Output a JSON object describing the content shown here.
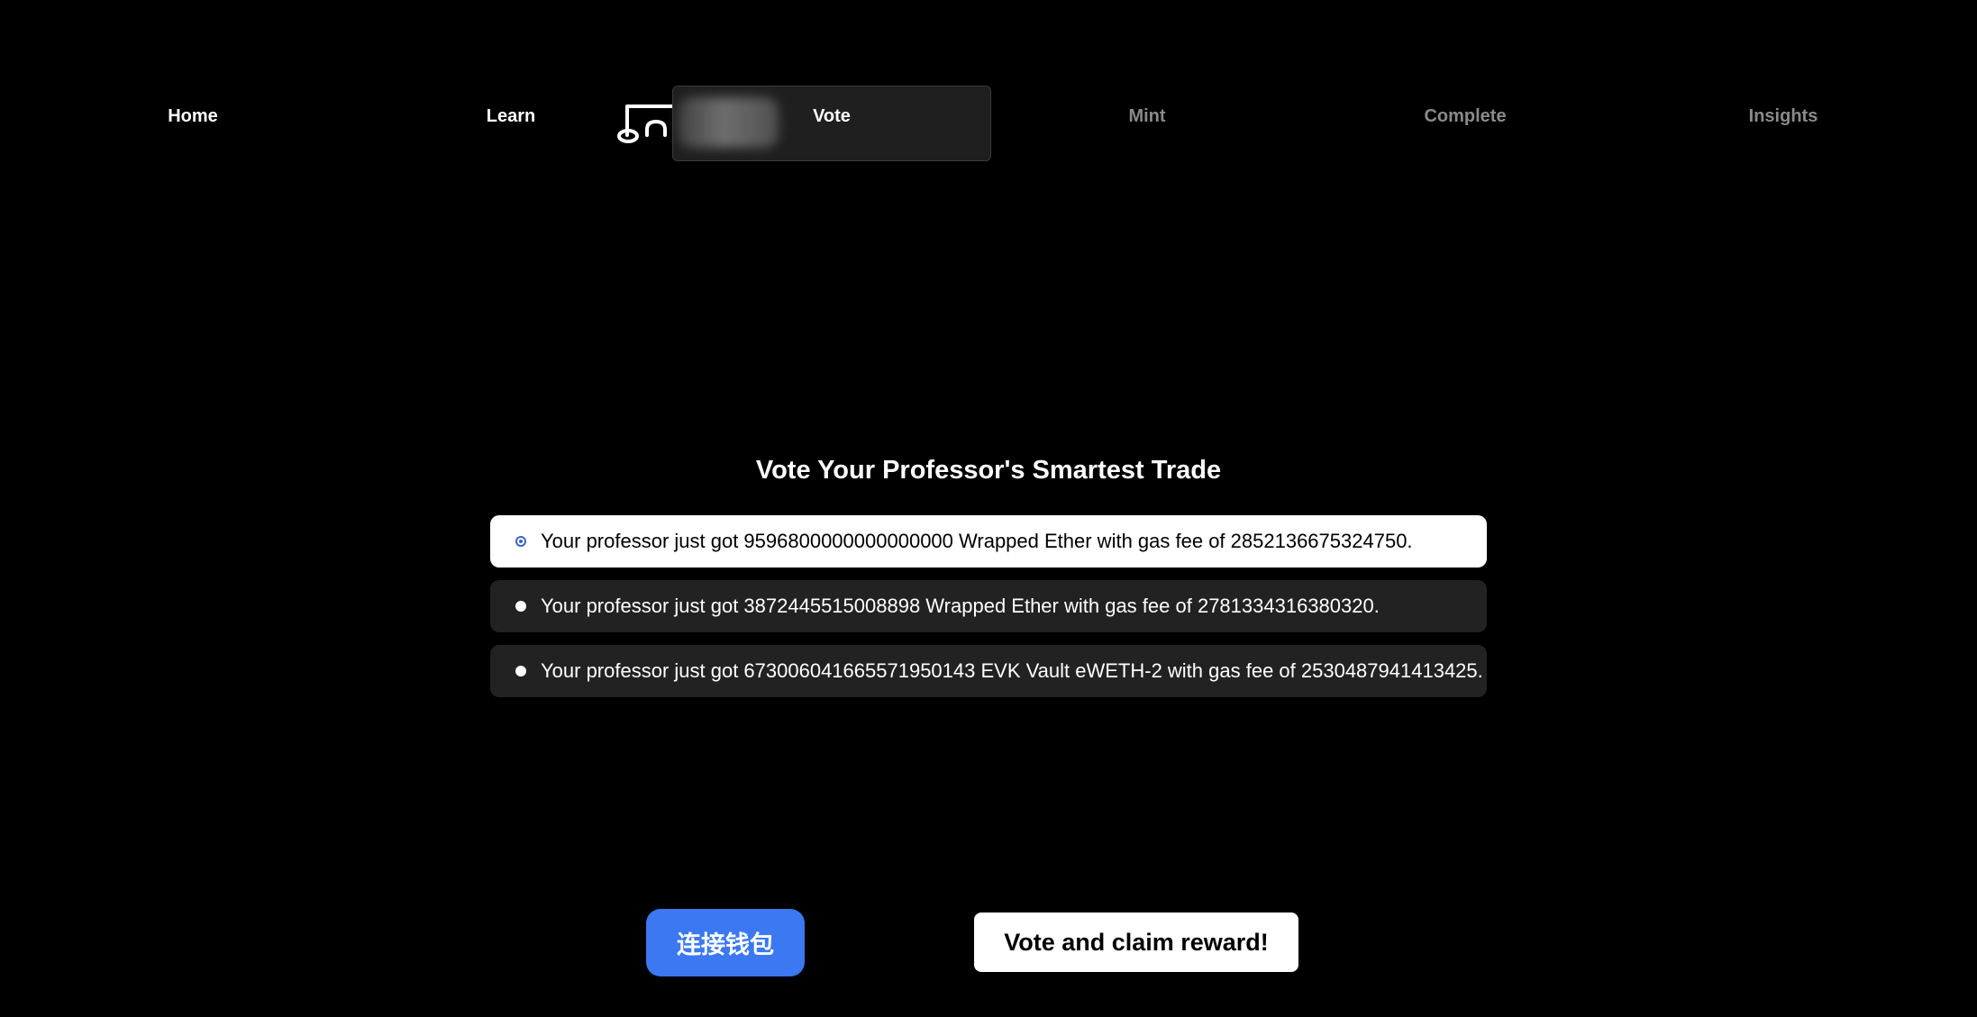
{
  "nav": {
    "items": [
      {
        "label": "Home",
        "state": "done"
      },
      {
        "label": "Learn",
        "state": "done"
      },
      {
        "label": "Vote",
        "state": "active"
      },
      {
        "label": "Mint",
        "state": "pending"
      },
      {
        "label": "Complete",
        "state": "pending"
      },
      {
        "label": "Insights",
        "state": "pending"
      }
    ],
    "logo_icon": "wallet-logo-icon"
  },
  "vote": {
    "title": "Vote Your Professor's Smartest Trade",
    "options": [
      {
        "text": "Your professor just got 9596800000000000000 Wrapped Ether with gas fee of 2852136675324750.",
        "selected": true
      },
      {
        "text": "Your professor just got 3872445515008898 Wrapped Ether with gas fee of 2781334316380320.",
        "selected": false
      },
      {
        "text": "Your professor just got 673006041665571950143 EVK Vault eWETH-2 with gas fee of 2530487941413425.",
        "selected": false
      }
    ]
  },
  "actions": {
    "connect_wallet_label": "连接钱包",
    "claim_label": "Vote and claim reward!"
  },
  "colors": {
    "background": "#000000",
    "active_tab": "#1f1f1f",
    "connect_button": "#3b78f2",
    "radio_accent": "#3b64c4",
    "option_bg": "#222222"
  }
}
